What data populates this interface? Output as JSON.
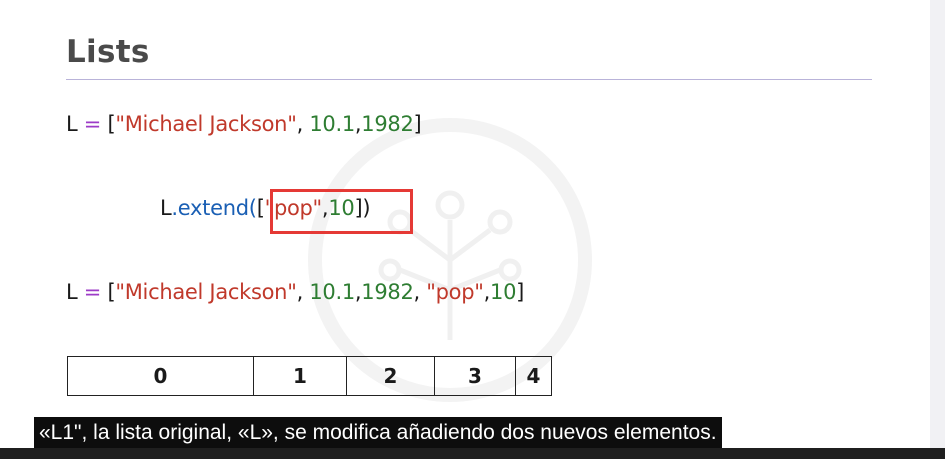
{
  "slide": {
    "title": "Lists",
    "line1": {
      "var": "L",
      "eq": " = ",
      "open": "[",
      "s1": "\"Michael Jackson\"",
      "sep1": ", ",
      "n1": "10.1",
      "sep2": ",",
      "n2": "1982",
      "close": "]"
    },
    "line2": {
      "obj": "L",
      "dot": ".",
      "method": "extend",
      "paren_open": "(",
      "open": "[",
      "s1": "\"pop\"",
      "sep1": ",",
      "n1": "10",
      "close": "]",
      "paren_close": ")"
    },
    "line3": {
      "var": "L",
      "eq": " = ",
      "open": "[",
      "s1": "\"Michael Jackson\"",
      "sep1": ", ",
      "n1": "10.1",
      "sep2": ",",
      "n2": "1982",
      "sep3": ", ",
      "s2": "\"pop\"",
      "sep4": ",",
      "n3": "10",
      "close": "]"
    },
    "index_cells": [
      "0",
      "1",
      "2",
      "3",
      "4"
    ]
  },
  "caption": {
    "text": "«L1\", la lista original, «L», se modifica añadiendo dos nuevos elementos."
  },
  "colors": {
    "operator": "#9c3bc7",
    "string": "#c0392b",
    "number": "#2e7d32",
    "method": "#1a5fb4",
    "highlight_box": "#e53935",
    "title": "#4a4a4a"
  },
  "icons": {
    "watermark": "tree-logo-watermark"
  }
}
